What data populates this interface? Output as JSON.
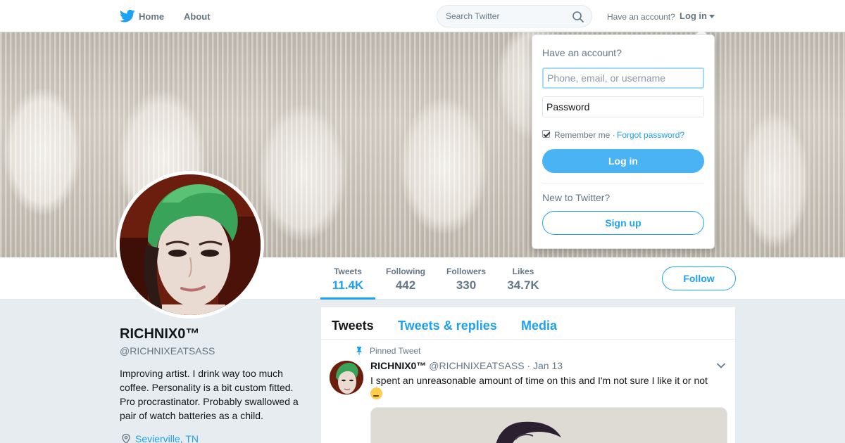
{
  "colors": {
    "accent": "#1da1f2",
    "background": "#e6ecf0",
    "login_button": "#4ab3f4"
  },
  "nav": {
    "logo_icon": "twitter-bird-icon",
    "home_label": "Home",
    "about_label": "About",
    "search_placeholder": "Search Twitter",
    "have_account": "Have an account?",
    "login_label": "Log in"
  },
  "profile": {
    "name": "RICHNIX0™",
    "handle": "@RICHNIXEATSASS",
    "bio": "Improving artist. I drink way too much coffee. Personality is a bit custom fitted. Pro procrastinator. Probably swallowed a pair of watch batteries as a child.",
    "location": "Sevierville, TN",
    "follow_label": "Follow"
  },
  "stats": [
    {
      "label": "Tweets",
      "value": "11.4K",
      "active": true
    },
    {
      "label": "Following",
      "value": "442"
    },
    {
      "label": "Followers",
      "value": "330"
    },
    {
      "label": "Likes",
      "value": "34.7K"
    }
  ],
  "tabs": [
    {
      "label": "Tweets",
      "active": true
    },
    {
      "label": "Tweets & replies"
    },
    {
      "label": "Media"
    }
  ],
  "tweet": {
    "pinned_label": "Pinned Tweet",
    "name": "RICHNIX0™",
    "handle": "@RICHNIXEATSASS",
    "date": "· Jan 13",
    "text": "I spent an unreasonable amount of time on this and I'm not sure I like it or not",
    "emoji": "thinking-face-emoji"
  },
  "login_dropdown": {
    "heading": "Have an account?",
    "username_placeholder": "Phone, email, or username",
    "password_placeholder": "Password",
    "remember_label": "Remember me ·",
    "remember_checked": true,
    "forgot_label": "Forgot password?",
    "login_button": "Log in",
    "new_label": "New to Twitter?",
    "signup_button": "Sign up"
  }
}
